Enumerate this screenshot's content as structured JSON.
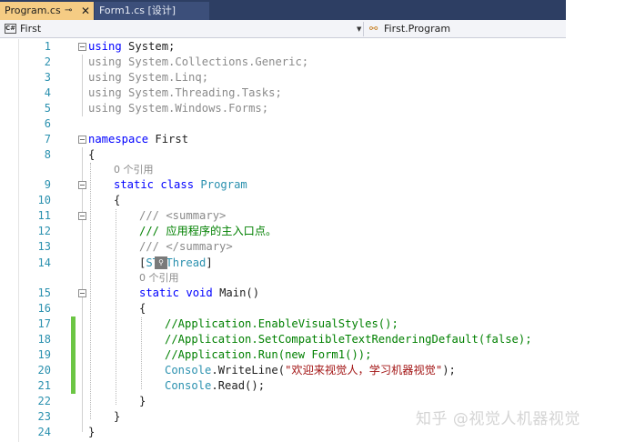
{
  "tabs": [
    {
      "label": "Program.cs",
      "pin_icon": "pin-icon",
      "close_icon": "close-icon",
      "active": true
    },
    {
      "label": "Form1.cs [设计]",
      "active": false
    }
  ],
  "navbar": {
    "project": "First",
    "project_icon": "csharp-project-icon",
    "member": "First.Program",
    "member_icon": "class-icon"
  },
  "editor": {
    "line_numbers": [
      "1",
      "2",
      "3",
      "4",
      "5",
      "6",
      "7",
      "8",
      "9",
      "10",
      "11",
      "12",
      "13",
      "14",
      "15",
      "16",
      "17",
      "18",
      "19",
      "20",
      "21",
      "22",
      "23",
      "24"
    ],
    "codelens": [
      "0 个引用",
      "0 个引用"
    ],
    "tokens": {
      "using": "using",
      "system": " System;",
      "u2": "using System.Collections.Generic;",
      "u3": "using System.Linq;",
      "u4": "using System.Threading.Tasks;",
      "u5": "using System.Windows.Forms;",
      "namespace": "namespace",
      "ns_name": " First",
      "open_brace": "{",
      "close_brace": "}",
      "static": "static",
      "class": "class",
      "program": "Program",
      "doc1": "/// <summary>",
      "doc2": "/// 应用程序的主入口点。",
      "doc3": "/// </summary>",
      "attr_open": "[",
      "attr_name": "STAThread",
      "attr_close": "]",
      "void": "void",
      "main": " Main()",
      "c17": "//Application.EnableVisualStyles();",
      "c18": "//Application.SetCompatibleTextRenderingDefault(false);",
      "c19": "//Application.Run(new Form1());",
      "console": "Console",
      "writeline": ".WriteLine(",
      "str": "\"欢迎来视觉人，学习机器视觉\"",
      "wl_end": ");",
      "read": ".Read();"
    }
  },
  "watermark": "知乎 @视觉人机器视觉",
  "colors": {
    "tab_active": "#f5cc84",
    "tabbar": "#2d3e63",
    "keyword": "#0000ff",
    "type": "#2b91af",
    "comment": "#008000",
    "string": "#a31515",
    "change_marker": "#6cc644"
  }
}
